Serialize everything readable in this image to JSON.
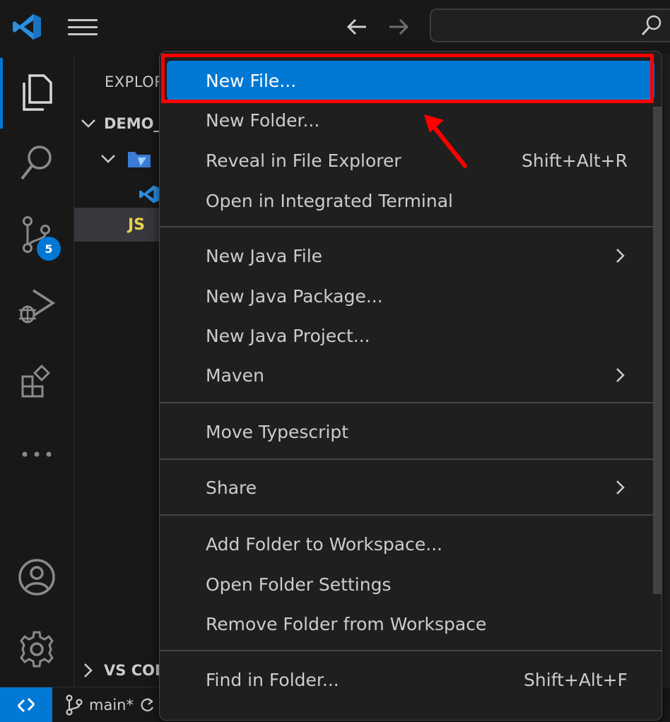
{
  "sidebar": {
    "title": "EXPLOR",
    "folder": "DEMO_",
    "js_file_label": "JS",
    "vs_code_section": "VS COD"
  },
  "activity": {
    "source_control_badge": "5"
  },
  "statusbar": {
    "branch": "main*"
  },
  "context_menu": {
    "groups": [
      [
        {
          "label": "New File...",
          "shortcut": "",
          "submenu": false,
          "highlighted": true
        },
        {
          "label": "New Folder...",
          "shortcut": "",
          "submenu": false
        },
        {
          "label": "Reveal in File Explorer",
          "shortcut": "Shift+Alt+R",
          "submenu": false
        },
        {
          "label": "Open in Integrated Terminal",
          "shortcut": "",
          "submenu": false
        }
      ],
      [
        {
          "label": "New Java File",
          "shortcut": "",
          "submenu": true
        },
        {
          "label": "New Java Package...",
          "shortcut": "",
          "submenu": false
        },
        {
          "label": "New Java Project...",
          "shortcut": "",
          "submenu": false
        },
        {
          "label": "Maven",
          "shortcut": "",
          "submenu": true
        }
      ],
      [
        {
          "label": "Move Typescript",
          "shortcut": "",
          "submenu": false
        }
      ],
      [
        {
          "label": "Share",
          "shortcut": "",
          "submenu": true
        }
      ],
      [
        {
          "label": "Add Folder to Workspace...",
          "shortcut": "",
          "submenu": false
        },
        {
          "label": "Open Folder Settings",
          "shortcut": "",
          "submenu": false
        },
        {
          "label": "Remove Folder from Workspace",
          "shortcut": "",
          "submenu": false
        }
      ],
      [
        {
          "label": "Find in Folder...",
          "shortcut": "Shift+Alt+F",
          "submenu": false
        }
      ]
    ]
  },
  "colors": {
    "accent": "#0078d4",
    "annotation": "#ff0000"
  }
}
